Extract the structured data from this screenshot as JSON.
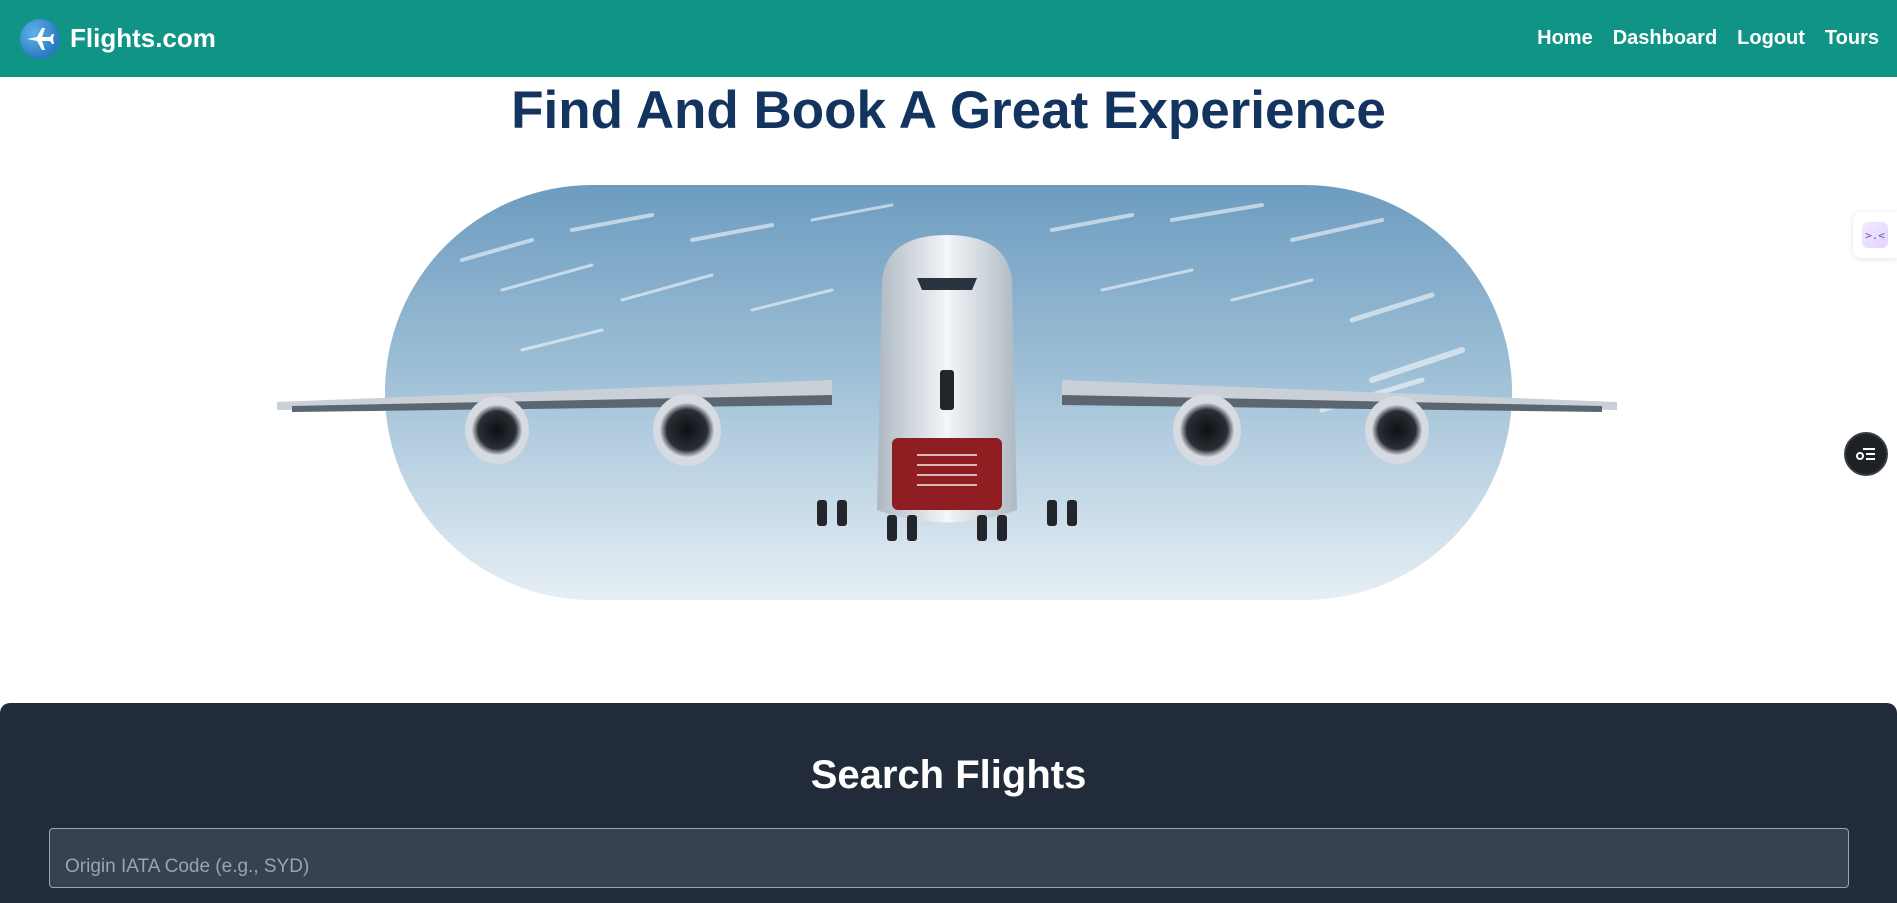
{
  "navbar": {
    "brand": "Flights.com",
    "logo_icon": "airplane-logo-icon",
    "links": [
      {
        "label": "Home"
      },
      {
        "label": "Dashboard"
      },
      {
        "label": "Logout"
      },
      {
        "label": "Tours"
      }
    ],
    "color": "#0f9486"
  },
  "hero": {
    "title": "Find And Book A Great Experience",
    "title_color": "#12345f",
    "image": "airplane-in-sky-image"
  },
  "search": {
    "title": "Search Flights",
    "origin_placeholder": "Origin IATA Code (e.g., SYD)",
    "origin_value": "",
    "panel_color": "#222b39"
  },
  "widgets": {
    "side_handle_icon": "extension-handle-icon",
    "side_handle_glyph": ">.<",
    "floating_icon": "list-toggle-icon"
  }
}
